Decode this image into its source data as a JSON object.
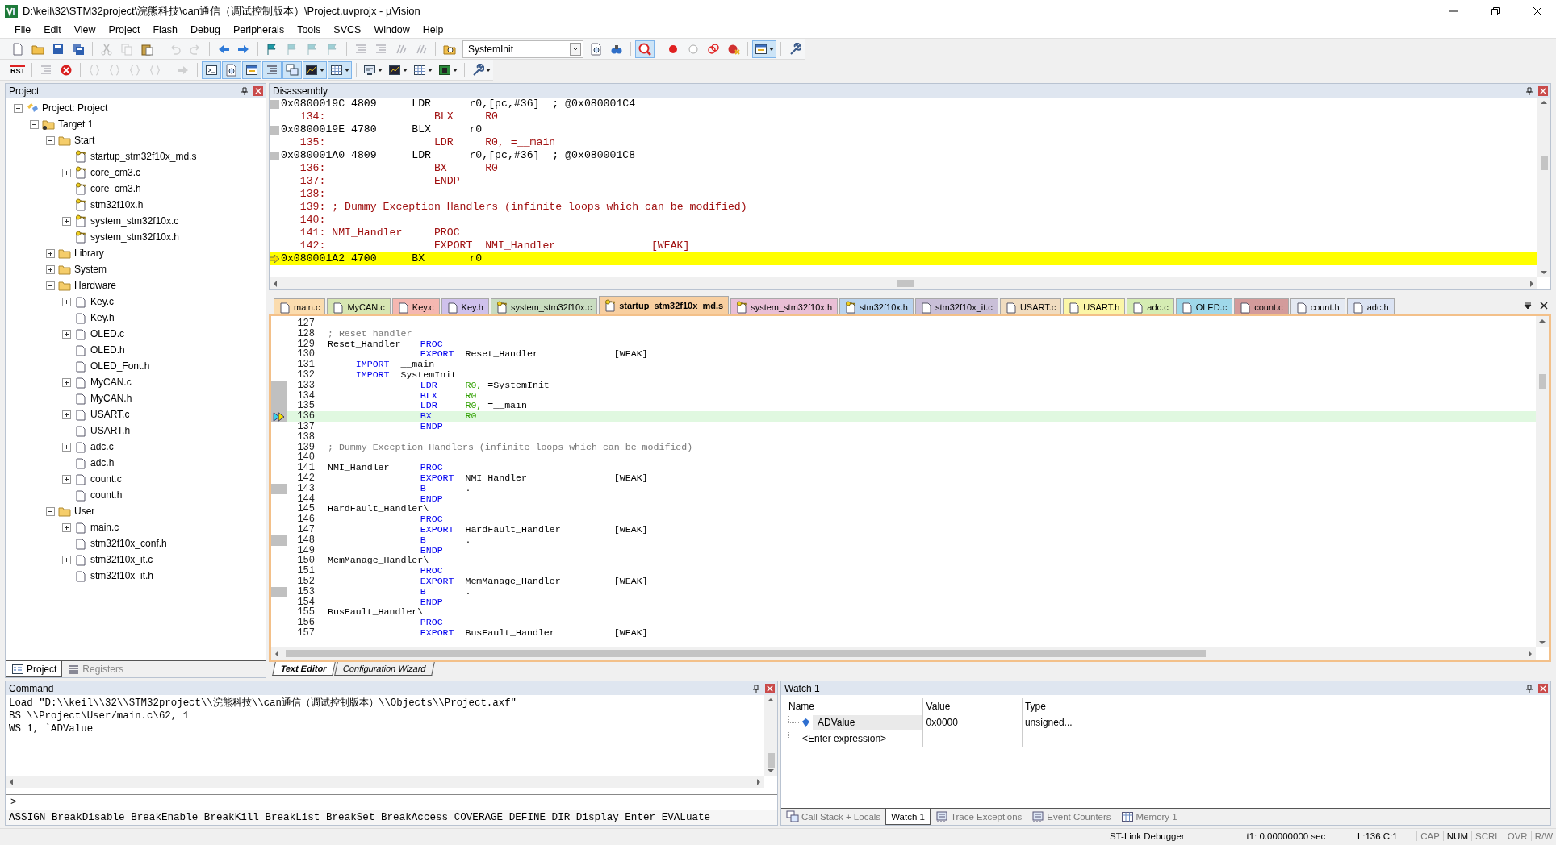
{
  "window": {
    "title": "D:\\keil\\32\\STM32project\\浣熊科技\\can通信（调试控制版本）\\Project.uvprojx - µVision"
  },
  "menu": [
    "File",
    "Edit",
    "View",
    "Project",
    "Flash",
    "Debug",
    "Peripherals",
    "Tools",
    "SVCS",
    "Window",
    "Help"
  ],
  "toolbars": [
    [
      [
        {
          "kind": "page",
          "disabled": false,
          "pressed": false,
          "dropdown": false
        },
        {
          "kind": "folder",
          "disabled": false,
          "pressed": false,
          "dropdown": false
        },
        {
          "kind": "floppy",
          "disabled": false,
          "pressed": false,
          "dropdown": false
        },
        {
          "kind": "floppies",
          "disabled": false,
          "pressed": false,
          "dropdown": false
        }
      ],
      [
        {
          "kind": "scissors",
          "disabled": true,
          "pressed": false,
          "dropdown": false
        },
        {
          "kind": "pages",
          "disabled": true,
          "pressed": false,
          "dropdown": false
        },
        {
          "kind": "clipboard",
          "disabled": false,
          "pressed": false,
          "dropdown": false
        }
      ],
      [
        {
          "kind": "undo",
          "disabled": true,
          "pressed": false,
          "dropdown": false
        },
        {
          "kind": "redo",
          "disabled": true,
          "pressed": false,
          "dropdown": false
        }
      ],
      [
        {
          "kind": "back",
          "disabled": false,
          "pressed": false,
          "dropdown": false
        },
        {
          "kind": "forward",
          "disabled": false,
          "pressed": false,
          "dropdown": false
        }
      ],
      [
        {
          "kind": "flag",
          "disabled": false,
          "pressed": false,
          "dropdown": false
        },
        {
          "kind": "flag",
          "disabled": true,
          "pressed": false,
          "dropdown": false
        },
        {
          "kind": "flag",
          "disabled": true,
          "pressed": false,
          "dropdown": false
        },
        {
          "kind": "flag",
          "disabled": true,
          "pressed": false,
          "dropdown": false
        }
      ],
      [
        {
          "kind": "lines",
          "disabled": true,
          "pressed": false,
          "dropdown": false
        },
        {
          "kind": "lines",
          "disabled": true,
          "pressed": false,
          "dropdown": false
        },
        {
          "kind": "slashes",
          "disabled": true,
          "pressed": false,
          "dropdown": false
        },
        {
          "kind": "slashes",
          "disabled": true,
          "pressed": false,
          "dropdown": false
        }
      ],
      [
        {
          "kind": "folder-search",
          "disabled": false,
          "pressed": false,
          "dropdown": false
        },
        {
          "kind": "combo",
          "value": "SystemInit",
          "dropdown": true
        },
        {
          "kind": "page-search",
          "disabled": false,
          "pressed": false,
          "dropdown": false
        },
        {
          "kind": "binoculars",
          "disabled": false,
          "pressed": false,
          "dropdown": false
        }
      ],
      [
        {
          "kind": "magnifier",
          "disabled": false,
          "pressed": true,
          "dropdown": false
        }
      ],
      [
        {
          "kind": "dot",
          "disabled": false,
          "pressed": false,
          "dropdown": false
        },
        {
          "kind": "ring",
          "disabled": false,
          "pressed": false,
          "dropdown": false
        },
        {
          "kind": "rings",
          "disabled": false,
          "pressed": false,
          "dropdown": false
        },
        {
          "kind": "dot-cross",
          "disabled": false,
          "pressed": false,
          "dropdown": false
        }
      ],
      [
        {
          "kind": "window",
          "disabled": false,
          "pressed": true,
          "dropdown": true
        }
      ],
      [
        {
          "kind": "wrench",
          "disabled": false,
          "pressed": false,
          "dropdown": false
        }
      ]
    ],
    [
      [
        {
          "kind": "reset",
          "label": "RST",
          "disabled": false,
          "pressed": false,
          "dropdown": false
        }
      ],
      [
        {
          "kind": "lines",
          "disabled": true,
          "pressed": false,
          "dropdown": false
        },
        {
          "kind": "stop",
          "disabled": false,
          "pressed": false,
          "dropdown": false
        }
      ],
      [
        {
          "kind": "braces",
          "disabled": true,
          "pressed": false,
          "dropdown": false
        },
        {
          "kind": "braces",
          "disabled": true,
          "pressed": false,
          "dropdown": false
        },
        {
          "kind": "braces",
          "disabled": true,
          "pressed": false,
          "dropdown": false
        },
        {
          "kind": "braces",
          "disabled": true,
          "pressed": false,
          "dropdown": false
        }
      ],
      [
        {
          "kind": "arrow",
          "disabled": true,
          "pressed": false,
          "dropdown": false
        }
      ],
      [
        {
          "kind": "console",
          "disabled": false,
          "pressed": true,
          "dropdown": false
        },
        {
          "kind": "page-search",
          "disabled": false,
          "pressed": true,
          "dropdown": false
        },
        {
          "kind": "window",
          "disabled": false,
          "pressed": true,
          "dropdown": false
        },
        {
          "kind": "lines",
          "disabled": false,
          "pressed": true,
          "dropdown": false
        },
        {
          "kind": "windows",
          "disabled": false,
          "pressed": true,
          "dropdown": false
        },
        {
          "kind": "chart",
          "disabled": false,
          "pressed": true,
          "dropdown": true
        },
        {
          "kind": "grid",
          "disabled": false,
          "pressed": true,
          "dropdown": true
        }
      ],
      [
        {
          "kind": "screen",
          "disabled": false,
          "pressed": false,
          "dropdown": true
        },
        {
          "kind": "chart",
          "disabled": false,
          "pressed": false,
          "dropdown": true
        },
        {
          "kind": "grid",
          "disabled": false,
          "pressed": false,
          "dropdown": true
        },
        {
          "kind": "board",
          "disabled": false,
          "pressed": false,
          "dropdown": true
        }
      ],
      [
        {
          "kind": "wrench",
          "disabled": false,
          "pressed": false,
          "dropdown": true
        }
      ]
    ]
  ],
  "project_panel": {
    "title": "Project",
    "tree": [
      {
        "label": "Project: Project",
        "kind": "project",
        "has_children": true,
        "expanded": true,
        "children": [
          {
            "label": "Target 1",
            "kind": "target",
            "has_children": true,
            "expanded": true,
            "children": [
              {
                "label": "Start",
                "kind": "group",
                "has_children": true,
                "expanded": true,
                "children": [
                  {
                    "label": "startup_stm32f10x_md.s",
                    "kind": "file-key",
                    "has_children": false,
                    "expanded": false
                  },
                  {
                    "label": "core_cm3.c",
                    "kind": "file-key",
                    "has_children": true,
                    "expanded": false
                  },
                  {
                    "label": "core_cm3.h",
                    "kind": "file-key",
                    "has_children": false,
                    "expanded": false
                  },
                  {
                    "label": "stm32f10x.h",
                    "kind": "file-key",
                    "has_children": false,
                    "expanded": false
                  },
                  {
                    "label": "system_stm32f10x.c",
                    "kind": "file-key",
                    "has_children": true,
                    "expanded": false
                  },
                  {
                    "label": "system_stm32f10x.h",
                    "kind": "file-key",
                    "has_children": false,
                    "expanded": false
                  }
                ]
              },
              {
                "label": "Library",
                "kind": "group",
                "has_children": true,
                "expanded": false
              },
              {
                "label": "System",
                "kind": "group",
                "has_children": true,
                "expanded": false
              },
              {
                "label": "Hardware",
                "kind": "group",
                "has_children": true,
                "expanded": true,
                "children": [
                  {
                    "label": "Key.c",
                    "kind": "file",
                    "has_children": true,
                    "expanded": false
                  },
                  {
                    "label": "Key.h",
                    "kind": "file",
                    "has_children": false,
                    "expanded": false
                  },
                  {
                    "label": "OLED.c",
                    "kind": "file",
                    "has_children": true,
                    "expanded": false
                  },
                  {
                    "label": "OLED.h",
                    "kind": "file",
                    "has_children": false,
                    "expanded": false
                  },
                  {
                    "label": "OLED_Font.h",
                    "kind": "file",
                    "has_children": false,
                    "expanded": false
                  },
                  {
                    "label": "MyCAN.c",
                    "kind": "file",
                    "has_children": true,
                    "expanded": false
                  },
                  {
                    "label": "MyCAN.h",
                    "kind": "file",
                    "has_children": false,
                    "expanded": false
                  },
                  {
                    "label": "USART.c",
                    "kind": "file",
                    "has_children": true,
                    "expanded": false
                  },
                  {
                    "label": "USART.h",
                    "kind": "file",
                    "has_children": false,
                    "expanded": false
                  },
                  {
                    "label": "adc.c",
                    "kind": "file",
                    "has_children": true,
                    "expanded": false
                  },
                  {
                    "label": "adc.h",
                    "kind": "file",
                    "has_children": false,
                    "expanded": false
                  },
                  {
                    "label": "count.c",
                    "kind": "file",
                    "has_children": true,
                    "expanded": false
                  },
                  {
                    "label": "count.h",
                    "kind": "file",
                    "has_children": false,
                    "expanded": false
                  }
                ]
              },
              {
                "label": "User",
                "kind": "group",
                "has_children": true,
                "expanded": true,
                "children": [
                  {
                    "label": "main.c",
                    "kind": "file",
                    "has_children": true,
                    "expanded": false
                  },
                  {
                    "label": "stm32f10x_conf.h",
                    "kind": "file",
                    "has_children": false,
                    "expanded": false
                  },
                  {
                    "label": "stm32f10x_it.c",
                    "kind": "file",
                    "has_children": true,
                    "expanded": false
                  },
                  {
                    "label": "stm32f10x_it.h",
                    "kind": "file",
                    "has_children": false,
                    "expanded": false
                  }
                ]
              }
            ]
          }
        ]
      }
    ],
    "tabs": [
      {
        "label": "Project",
        "selected": true
      },
      {
        "label": "Registers",
        "selected": false
      }
    ]
  },
  "disassembly": {
    "title": "Disassembly",
    "lines": [
      {
        "kind": "asm",
        "address": "0x0800019C",
        "opcode": "4809",
        "mnemonic": "LDR",
        "operands": "r0,[pc,#36]",
        "comment": "; @0x080001C4",
        "current": false
      },
      {
        "kind": "source",
        "line": "134:",
        "keyword": "BLX",
        "operands": "R0",
        "current": false
      },
      {
        "kind": "asm",
        "address": "0x0800019E",
        "opcode": "4780",
        "mnemonic": "BLX",
        "operands": "r0",
        "current": false
      },
      {
        "kind": "source",
        "line": "135:",
        "keyword": "LDR",
        "operands": "R0, =__main",
        "current": false
      },
      {
        "kind": "asm",
        "address": "0x080001A0",
        "opcode": "4809",
        "mnemonic": "LDR",
        "operands": "r0,[pc,#36]",
        "comment": "; @0x080001C8",
        "current": false
      },
      {
        "kind": "source",
        "line": "136:",
        "keyword": "BX",
        "operands": "R0",
        "current": false
      },
      {
        "kind": "source",
        "line": "137:",
        "keyword": "ENDP",
        "current": false
      },
      {
        "kind": "source",
        "line": "138:",
        "current": false
      },
      {
        "kind": "source",
        "line": "139:",
        "comment": "; Dummy Exception Handlers (infinite loops which can be modified)",
        "current": false
      },
      {
        "kind": "source",
        "line": "140:",
        "current": false
      },
      {
        "kind": "source",
        "line": "141:",
        "label": "NMI_Handler",
        "keyword": "PROC",
        "current": false
      },
      {
        "kind": "source",
        "line": "142:",
        "keyword": "EXPORT",
        "operands": "NMI_Handler",
        "attribute": "[WEAK]",
        "current": false
      },
      {
        "kind": "asm",
        "address": "0x080001A2",
        "opcode": "4700",
        "mnemonic": "BX",
        "operands": "r0",
        "current": true
      }
    ]
  },
  "editor": {
    "tabs": [
      {
        "label": "main.c",
        "kind": "file",
        "color": "#fbdcae",
        "selected": false
      },
      {
        "label": "MyCAN.c",
        "kind": "file",
        "color": "#d7e6b2",
        "selected": false
      },
      {
        "label": "Key.c",
        "kind": "file",
        "color": "#f5b7b1",
        "selected": false
      },
      {
        "label": "Key.h",
        "kind": "file",
        "color": "#cfc1ec",
        "selected": false
      },
      {
        "label": "system_stm32f10x.c",
        "kind": "file-key",
        "color": "#c9dcc0",
        "selected": false
      },
      {
        "label": "startup_stm32f10x_md.s",
        "kind": "file-key",
        "color": "#f8cfa0",
        "selected": true
      },
      {
        "label": "system_stm32f10x.h",
        "kind": "file-key",
        "color": "#e9bfd6",
        "selected": false
      },
      {
        "label": "stm32f10x.h",
        "kind": "file-key",
        "color": "#b9d3ee",
        "selected": false
      },
      {
        "label": "stm32f10x_it.c",
        "kind": "file",
        "color": "#c9bfd8",
        "selected": false
      },
      {
        "label": "USART.c",
        "kind": "file",
        "color": "#f0dcc0",
        "selected": false
      },
      {
        "label": "USART.h",
        "kind": "file",
        "color": "#fbf6a8",
        "selected": false
      },
      {
        "label": "adc.c",
        "kind": "file",
        "color": "#d5ecb2",
        "selected": false
      },
      {
        "label": "OLED.c",
        "kind": "file",
        "color": "#9fd8ea",
        "selected": false
      },
      {
        "label": "count.c",
        "kind": "file",
        "color": "#d39b9b",
        "selected": false
      },
      {
        "label": "count.h",
        "kind": "file",
        "color": "#e4e9f2",
        "selected": false
      },
      {
        "label": "adc.h",
        "kind": "file",
        "color": "#dbe3f3",
        "selected": false
      }
    ],
    "lines": [
      {
        "number": "127",
        "kind": "code",
        "executable": false,
        "current": false
      },
      {
        "number": "128",
        "kind": "code",
        "comment": "; Reset handler",
        "executable": false,
        "current": false
      },
      {
        "number": "129",
        "kind": "code",
        "label": "Reset_Handler",
        "keyword": "PROC",
        "executable": false,
        "current": false
      },
      {
        "number": "130",
        "kind": "code",
        "keyword": "EXPORT",
        "operands": [
          {
            "kind": "symbol",
            "text": "Reset_Handler"
          }
        ],
        "attribute": "[WEAK]",
        "executable": false,
        "current": false
      },
      {
        "number": "131",
        "kind": "import",
        "keyword": "IMPORT",
        "operands": [
          {
            "kind": "symbol",
            "text": "__main"
          }
        ],
        "executable": false,
        "current": false
      },
      {
        "number": "132",
        "kind": "import",
        "keyword": "IMPORT",
        "operands": [
          {
            "kind": "symbol",
            "text": "SystemInit"
          }
        ],
        "executable": false,
        "current": false
      },
      {
        "number": "133",
        "kind": "code",
        "keyword": "LDR",
        "operands": [
          {
            "kind": "register",
            "text": "R0,"
          },
          {
            "kind": "symbol",
            "text": "=SystemInit"
          }
        ],
        "executable": true,
        "current": false
      },
      {
        "number": "134",
        "kind": "code",
        "keyword": "BLX",
        "operands": [
          {
            "kind": "register",
            "text": "R0"
          }
        ],
        "executable": true,
        "current": false
      },
      {
        "number": "135",
        "kind": "code",
        "keyword": "LDR",
        "operands": [
          {
            "kind": "register",
            "text": "R0,"
          },
          {
            "kind": "symbol",
            "text": "=__main"
          }
        ],
        "executable": true,
        "current": false
      },
      {
        "number": "136",
        "kind": "code",
        "keyword": "BX",
        "operands": [
          {
            "kind": "register",
            "text": "R0"
          }
        ],
        "executable": true,
        "current": true
      },
      {
        "number": "137",
        "kind": "code",
        "keyword": "ENDP",
        "executable": false,
        "current": false
      },
      {
        "number": "138",
        "kind": "code",
        "executable": false,
        "current": false
      },
      {
        "number": "139",
        "kind": "code",
        "comment": "; Dummy Exception Handlers (infinite loops which can be modified)",
        "executable": false,
        "current": false
      },
      {
        "number": "140",
        "kind": "code",
        "executable": false,
        "current": false
      },
      {
        "number": "141",
        "kind": "code",
        "label": "NMI_Handler",
        "keyword": "PROC",
        "executable": false,
        "current": false
      },
      {
        "number": "142",
        "kind": "code",
        "keyword": "EXPORT",
        "operands": [
          {
            "kind": "symbol",
            "text": "NMI_Handler"
          }
        ],
        "attribute": "[WEAK]",
        "executable": false,
        "current": false
      },
      {
        "number": "143",
        "kind": "code",
        "keyword": "B",
        "operands": [
          {
            "kind": "symbol",
            "text": "."
          }
        ],
        "executable": true,
        "current": false
      },
      {
        "number": "144",
        "kind": "code",
        "keyword": "ENDP",
        "executable": false,
        "current": false
      },
      {
        "number": "145",
        "kind": "code",
        "label": "HardFault_Handler\\",
        "executable": false,
        "current": false
      },
      {
        "number": "146",
        "kind": "code",
        "keyword": "PROC",
        "executable": false,
        "current": false
      },
      {
        "number": "147",
        "kind": "code",
        "keyword": "EXPORT",
        "operands": [
          {
            "kind": "symbol",
            "text": "HardFault_Handler"
          }
        ],
        "attribute": "[WEAK]",
        "executable": false,
        "current": false
      },
      {
        "number": "148",
        "kind": "code",
        "keyword": "B",
        "operands": [
          {
            "kind": "symbol",
            "text": "."
          }
        ],
        "executable": true,
        "current": false
      },
      {
        "number": "149",
        "kind": "code",
        "keyword": "ENDP",
        "executable": false,
        "current": false
      },
      {
        "number": "150",
        "kind": "code",
        "label": "MemManage_Handler\\",
        "executable": false,
        "current": false
      },
      {
        "number": "151",
        "kind": "code",
        "keyword": "PROC",
        "executable": false,
        "current": false
      },
      {
        "number": "152",
        "kind": "code",
        "keyword": "EXPORT",
        "operands": [
          {
            "kind": "symbol",
            "text": "MemManage_Handler"
          }
        ],
        "attribute": "[WEAK]",
        "executable": false,
        "current": false
      },
      {
        "number": "153",
        "kind": "code",
        "keyword": "B",
        "operands": [
          {
            "kind": "symbol",
            "text": "."
          }
        ],
        "executable": true,
        "current": false
      },
      {
        "number": "154",
        "kind": "code",
        "keyword": "ENDP",
        "executable": false,
        "current": false
      },
      {
        "number": "155",
        "kind": "code",
        "label": "BusFault_Handler\\",
        "executable": false,
        "current": false
      },
      {
        "number": "156",
        "kind": "code",
        "keyword": "PROC",
        "executable": false,
        "current": false
      },
      {
        "number": "157",
        "kind": "code",
        "keyword": "EXPORT",
        "operands": [
          {
            "kind": "symbol",
            "text": "BusFault_Handler"
          }
        ],
        "attribute": "[WEAK]",
        "executable": false,
        "current": false
      }
    ],
    "bottom_tabs": [
      {
        "label": "Text Editor",
        "selected": true
      },
      {
        "label": "Configuration Wizard",
        "selected": false
      }
    ]
  },
  "command": {
    "title": "Command",
    "lines": [
      "Load \"D:\\\\keil\\\\32\\\\STM32project\\\\浣熊科技\\\\can通信（调试控制版本）\\\\Objects\\\\Project.axf\"",
      "BS \\\\Project\\User/main.c\\62, 1",
      "WS 1, `ADValue"
    ],
    "prompt": ">",
    "hint": "ASSIGN BreakDisable BreakEnable BreakKill BreakList BreakSet BreakAccess COVERAGE DEFINE DIR Display Enter EVALuate"
  },
  "watch": {
    "title": "Watch 1",
    "columns": [
      "Name",
      "Value",
      "Type"
    ],
    "rows": [
      {
        "kind": "variable",
        "name": "ADValue",
        "value": "0x0000",
        "type": "unsigned..."
      },
      {
        "kind": "placeholder",
        "name": "<Enter expression>"
      }
    ],
    "tabs": [
      {
        "label": "Call Stack + Locals",
        "kind": "stack",
        "selected": false
      },
      {
        "label": "Watch 1",
        "kind": "none",
        "selected": true
      },
      {
        "label": "Trace Exceptions",
        "kind": "chip",
        "selected": false
      },
      {
        "label": "Event Counters",
        "kind": "chip",
        "selected": false
      },
      {
        "label": "Memory 1",
        "kind": "grid",
        "selected": false
      }
    ]
  },
  "status_bar": {
    "debugger": "ST-Link Debugger",
    "time": "t1: 0.00000000 sec",
    "position": "L:136 C:1",
    "indicators": [
      {
        "label": "CAP",
        "on": false
      },
      {
        "label": "NUM",
        "on": true
      },
      {
        "label": "SCRL",
        "on": false
      },
      {
        "label": "OVR",
        "on": false
      },
      {
        "label": "R/W",
        "on": false
      }
    ]
  }
}
